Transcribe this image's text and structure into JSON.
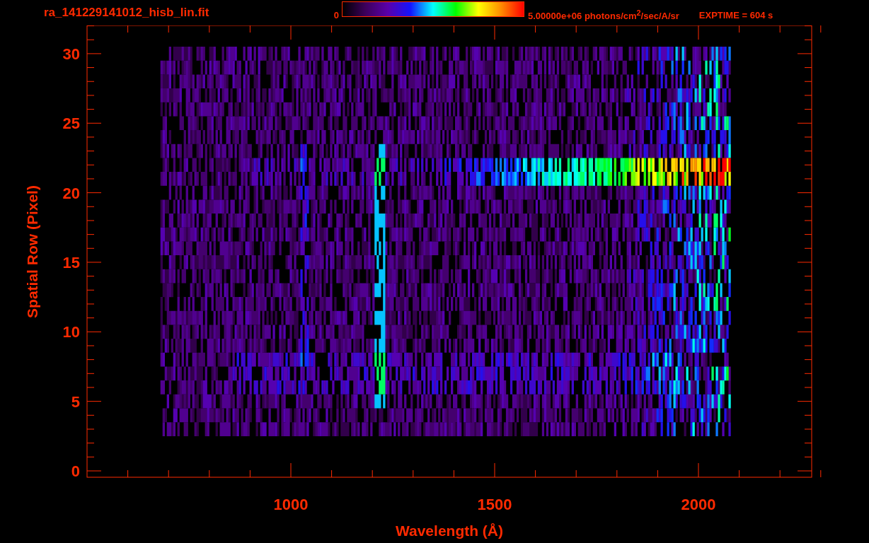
{
  "title": "ra_141229141012_hisb_lin.fit",
  "colorbar": {
    "min_label": "0",
    "max_label": "5.00000e+06 photons/cm$^{2}$/sec/A/sr"
  },
  "exposure": "EXPTIME = 604 s",
  "x_axis": {
    "title": "Wavelength (Å)",
    "ticks": [
      "1000",
      "1500",
      "2000"
    ]
  },
  "y_axis": {
    "title": "Spatial Row (Pixel)",
    "ticks": [
      "30",
      "25",
      "20",
      "15",
      "10",
      "5",
      "0"
    ]
  }
}
